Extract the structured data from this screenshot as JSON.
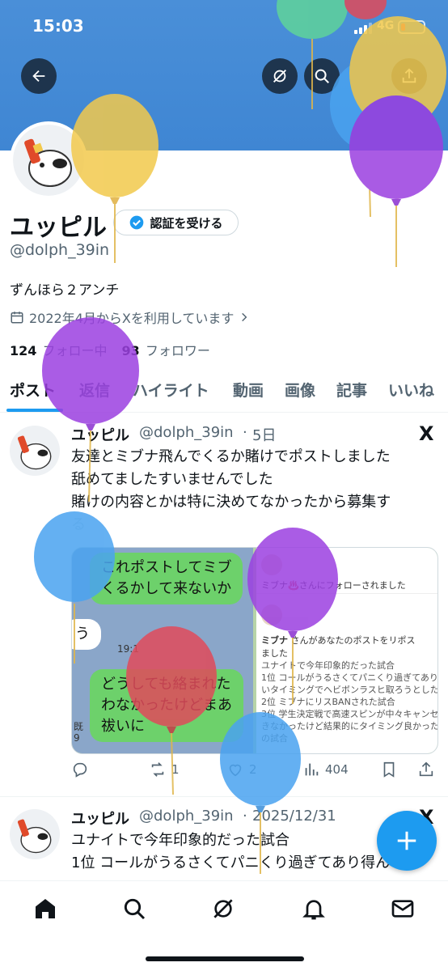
{
  "status": {
    "time": "15:03",
    "network": "4G"
  },
  "profile": {
    "name": "ユッピル",
    "verify_label": "認証を受ける",
    "handle": "@dolph_39in",
    "bio": "ずんほら２アンチ",
    "joined": "2022年4月からXを利用しています",
    "following_count": "124",
    "following_label": "フォロー中",
    "followers_count": "93",
    "followers_label": "フォロワー"
  },
  "tabs": [
    "ポスト",
    "返信",
    "ハイライト",
    "動画",
    "画像",
    "記事",
    "いいね"
  ],
  "posts": [
    {
      "name": "ユッピル",
      "handle": "@dolph_39in",
      "sep": "·",
      "time": "5日",
      "x_logo": "X",
      "lines": [
        "友達とミブナ飛んでくるか賭けでポストしました",
        "舐めてましたすいませんでした",
        "賭けの内容とかは特に決めてなかったから募集す",
        "る"
      ],
      "media": {
        "chat_bubble_1a": "これポストしてミブ",
        "chat_bubble_1b": "くるかして来ないか",
        "chat_bubble_2": "う",
        "chat_time": "19:1",
        "chat_bubble_3a": "どうしても絡まれた",
        "chat_bubble_3b": "わなかったけどまあ",
        "chat_bubble_3c": "祓いに",
        "chat_read": "既",
        "chat_read2": "9",
        "notif_follow": "ミブナ♨️さんにフォローされました",
        "notif_repost_name": "ミブナ",
        "notif_repost": "さんがあなたのポストをリポス",
        "notif_repost2": "ました",
        "notif_lines": [
          "ユナイトで今年印象的だった試合",
          "1位 コールがうるさくてパニくり過ぎてあり",
          "いタイミングでヘビボンラスヒ取ろうとした",
          "2位 ミブナにリスBANされた試合",
          "3位 学生決定戦で高速スピンが中々キャンセ",
          "きなかったけど結果的にタイミング良かった",
          "の試合"
        ]
      },
      "replies": "",
      "reposts": "1",
      "likes": "2",
      "views": "404"
    },
    {
      "name": "ユッピル",
      "handle": "@dolph_39in",
      "sep": "·",
      "time": "2025/12/31",
      "x_logo": "X",
      "lines": [
        "ユナイトで今年印象的だった試合",
        "1位 コールがうるさくてパニくり過ぎてあり得ん"
      ]
    }
  ],
  "colors": {
    "accent": "#1d9bf0",
    "banner": "#4a8fd8",
    "balloon_yellow": "#f2c94c",
    "balloon_purple": "#9b3fe0",
    "balloon_blue": "#4aa3f0",
    "balloon_red": "#e04a5a",
    "balloon_green": "#5fd39a"
  },
  "icons": [
    "back-arrow-icon",
    "grok-icon",
    "search-icon",
    "share-icon",
    "verified-badge-icon",
    "calendar-icon",
    "chevron-right-icon",
    "reply-icon",
    "repost-icon",
    "like-icon",
    "views-icon",
    "bookmark-icon",
    "share-post-icon",
    "home-icon",
    "compose-plus-icon",
    "notifications-icon",
    "messages-icon"
  ]
}
